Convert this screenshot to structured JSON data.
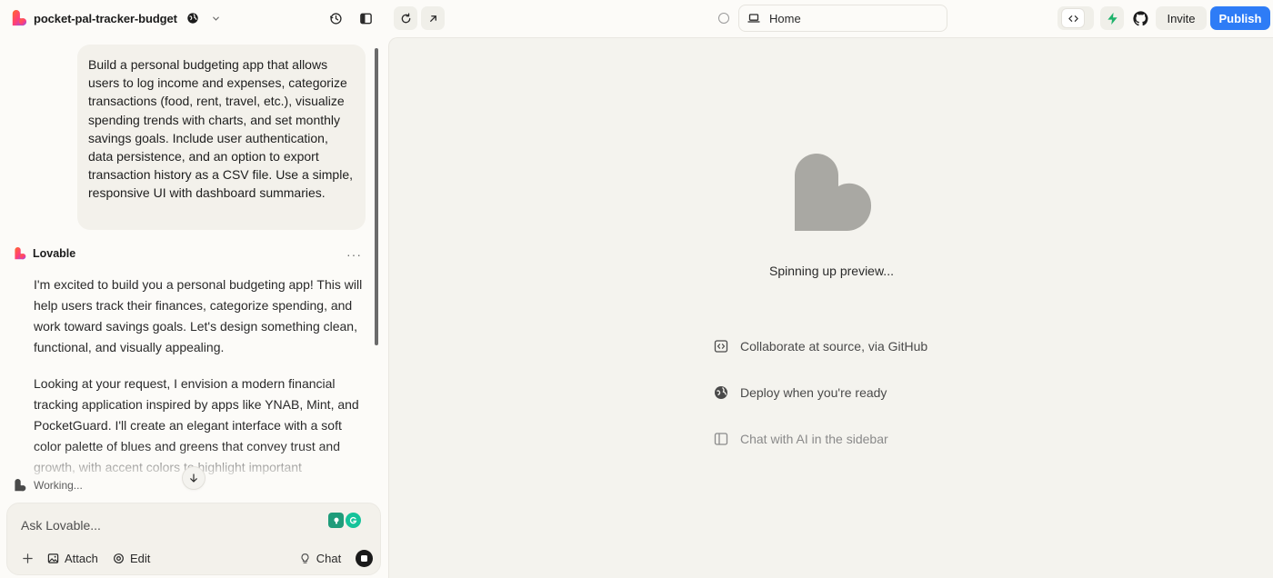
{
  "header": {
    "project_name": "pocket-pal-tracker-budget",
    "route": "Home",
    "invite_label": "Invite",
    "publish_label": "Publish"
  },
  "chat": {
    "user_message": "Build a personal budgeting app that allows users to log income and expenses, categorize transactions (food, rent, travel, etc.), visualize spending trends with charts, and set monthly savings goals. Include user authentication, data persistence, and an option to export transaction history as a CSV file. Use a simple, responsive UI with dashboard summaries.",
    "assistant_name": "Lovable",
    "assistant_paragraphs": [
      "I'm excited to build you a personal budgeting app! This will help users track their finances, categorize spending, and work toward savings goals. Let's design something clean, functional, and visually appealing.",
      "Looking at your request, I envision a modern financial tracking application inspired by apps like YNAB, Mint, and PocketGuard. I'll create an elegant interface with a soft color palette of blues and greens that convey trust and growth, with accent colors to highlight important"
    ],
    "more_label": "···",
    "working_label": "Working...",
    "input_placeholder": "Ask Lovable...",
    "attach_label": "Attach",
    "edit_label": "Edit",
    "chat_mode_label": "Chat"
  },
  "preview": {
    "status_text": "Spinning up preview...",
    "features": [
      {
        "icon": "code-icon",
        "label": "Collaborate at source, via GitHub"
      },
      {
        "icon": "globe-icon",
        "label": "Deploy when you're ready"
      },
      {
        "icon": "sidebar-icon",
        "label": "Chat with AI in the sidebar"
      }
    ]
  },
  "colors": {
    "accent": "#2e7cf6",
    "background": "#fcfbf8",
    "preview_bg": "#f4f3ee",
    "placeholder_heart": "#a9a8a3",
    "bolt_green": "#1fb26b"
  }
}
